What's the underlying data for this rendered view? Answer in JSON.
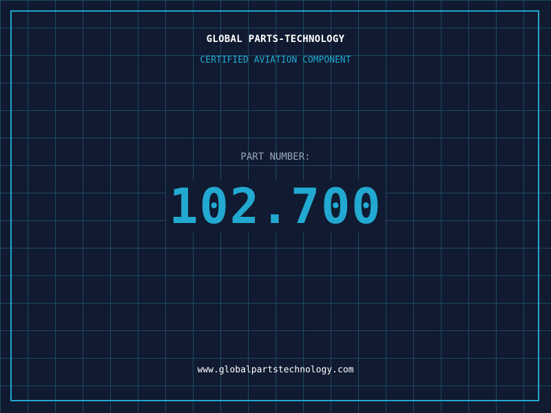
{
  "header": {
    "company": "GLOBAL PARTS-TECHNOLOGY",
    "subtitle": "CERTIFIED AVIATION COMPONENT"
  },
  "part": {
    "label": "PART NUMBER:",
    "number": "102.700"
  },
  "footer": {
    "website": "www.globalpartstechnology.com"
  },
  "colors": {
    "background": "#101a30",
    "grid": "#1f4a63",
    "accent": "#22a9d1",
    "text": "#ffffff",
    "muted": "#9aa8bb"
  }
}
